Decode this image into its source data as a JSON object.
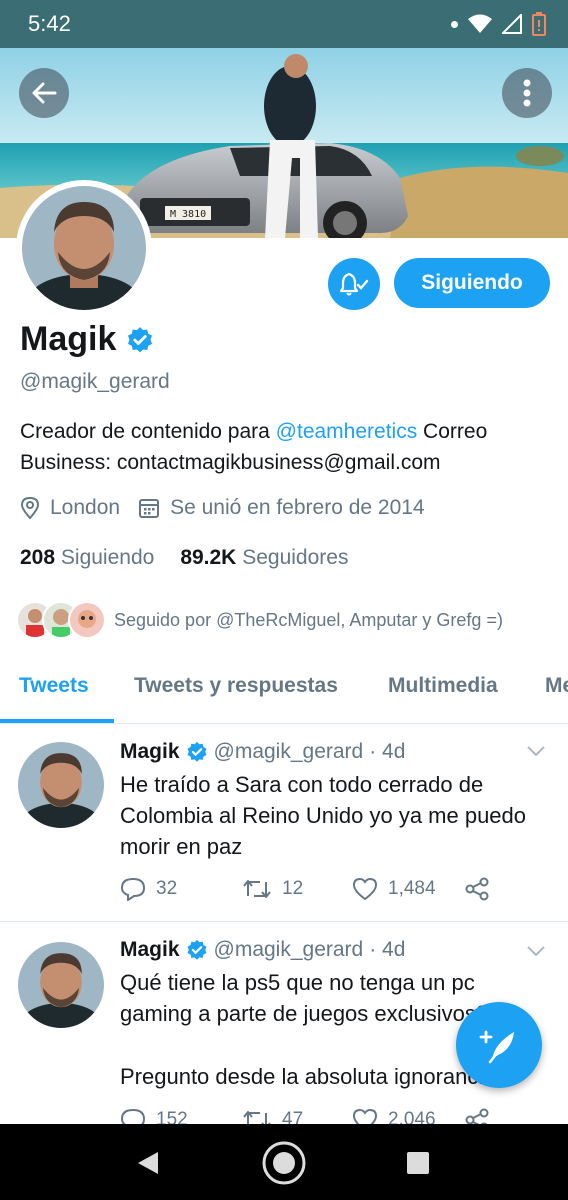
{
  "status_bar": {
    "time": "5:42"
  },
  "profile": {
    "name": "Magik",
    "handle": "@magik_gerard",
    "bio_prefix": "Creador de contenido para ",
    "bio_link": "@teamheretics",
    "bio_suffix": " Correo Business: contactmagikbusiness@gmail.com",
    "location": "London",
    "joined": "Se unió en febrero de 2014",
    "following_count": "208",
    "following_label": "Siguiendo",
    "followers_count": "89.2K",
    "followers_label": "Seguidores",
    "followed_by": "Seguido por @TheRcMiguel, Amputar y Grefg =)",
    "follow_button": "Siguiendo",
    "plate_text": "M 3810"
  },
  "tabs": [
    {
      "label": "Tweets",
      "active": true
    },
    {
      "label": "Tweets y respuestas",
      "active": false
    },
    {
      "label": "Multimedia",
      "active": false
    },
    {
      "label": "Me",
      "active": false
    }
  ],
  "tweets": [
    {
      "name": "Magik",
      "handle": "@magik_gerard",
      "age": "· 4d",
      "text": "He traído a Sara con todo cerrado de Colombia al Reino Unido yo ya me puedo morir en paz",
      "replies": "32",
      "retweets": "12",
      "likes": "1,484"
    },
    {
      "name": "Magik",
      "handle": "@magik_gerard",
      "age": "· 4d",
      "text_line1": "Qué tiene la ps5 que no tenga un pc gaming a parte de juegos exclusivos?",
      "text_line2": "Pregunto desde la absoluta ignorancia",
      "replies": "152",
      "retweets": "47",
      "likes": "2,046"
    }
  ],
  "colors": {
    "accent": "#1da1f2",
    "status_bar": "#3b6e74",
    "secondary_text": "#657786"
  },
  "icons": [
    "back-arrow-icon",
    "more-vertical-icon",
    "bell-check-icon",
    "verified-badge-icon",
    "location-pin-icon",
    "calendar-icon",
    "reply-icon",
    "retweet-icon",
    "like-icon",
    "share-icon",
    "chevron-down-icon",
    "compose-icon",
    "nav-back-icon",
    "nav-home-icon",
    "nav-recents-icon"
  ]
}
